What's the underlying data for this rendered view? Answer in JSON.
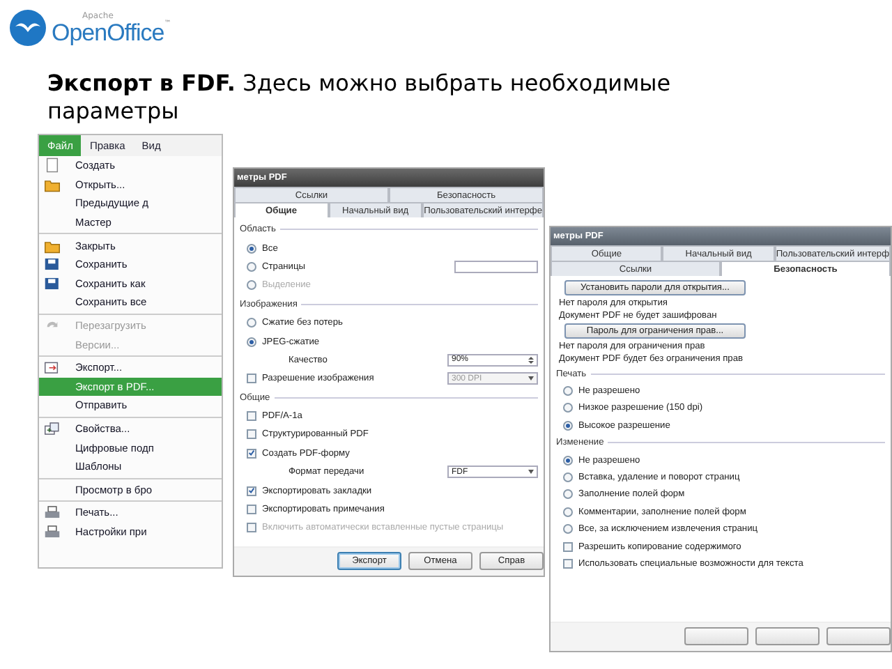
{
  "logo": {
    "vendor": "Apache",
    "name": "OpenOffice",
    "mark": "™"
  },
  "heading": "**Экспорт в FDF.** Здесь можно выбрать необходимые параметры",
  "menu": {
    "menubar": [
      {
        "label": "Файл",
        "selected": true
      },
      {
        "label": "Правка",
        "selected": false
      },
      {
        "label": "Вид",
        "selected": false
      }
    ],
    "items": [
      {
        "kind": "item",
        "label": "Создать",
        "selected": false,
        "disabled": false
      },
      {
        "kind": "item",
        "label": "Открыть...",
        "selected": false,
        "disabled": false
      },
      {
        "kind": "item",
        "label": "Предыдущие д",
        "selected": false,
        "disabled": false
      },
      {
        "kind": "item",
        "label": "Мастер",
        "selected": false,
        "disabled": false
      },
      {
        "kind": "separator"
      },
      {
        "kind": "item",
        "label": "Закрыть",
        "selected": false,
        "disabled": false
      },
      {
        "kind": "item",
        "label": "Сохранить",
        "selected": false,
        "disabled": false
      },
      {
        "kind": "item",
        "label": "Сохранить как",
        "selected": false,
        "disabled": false
      },
      {
        "kind": "item",
        "label": "Сохранить все",
        "selected": false,
        "disabled": false
      },
      {
        "kind": "separator"
      },
      {
        "kind": "item",
        "label": "Перезагрузить",
        "selected": false,
        "disabled": true
      },
      {
        "kind": "item",
        "label": "Версии...",
        "selected": false,
        "disabled": true
      },
      {
        "kind": "separator"
      },
      {
        "kind": "item",
        "label": "Экспорт...",
        "selected": false,
        "disabled": false
      },
      {
        "kind": "item",
        "label": "Экспорт в PDF...",
        "selected": true,
        "disabled": false
      },
      {
        "kind": "item",
        "label": "Отправить",
        "selected": false,
        "disabled": false
      },
      {
        "kind": "separator"
      },
      {
        "kind": "item",
        "label": "Свойства...",
        "selected": false,
        "disabled": false
      },
      {
        "kind": "item",
        "label": "Цифровые подп",
        "selected": false,
        "disabled": false
      },
      {
        "kind": "item",
        "label": "Шаблоны",
        "selected": false,
        "disabled": false
      },
      {
        "kind": "separator"
      },
      {
        "kind": "item",
        "label": "Просмотр в бро",
        "selected": false,
        "disabled": false
      },
      {
        "kind": "separator"
      },
      {
        "kind": "item",
        "label": "Печать...",
        "selected": false,
        "disabled": false
      },
      {
        "kind": "item",
        "label": "Настройки при",
        "selected": false,
        "disabled": false
      }
    ]
  },
  "dialogs": [
    {
      "title": "метры PDF",
      "tabs_back": [
        {
          "label": "Ссылки",
          "selected": false
        },
        {
          "label": "Безопасность",
          "selected": false
        }
      ],
      "tabs_front": [
        {
          "label": "Общие",
          "selected": true
        },
        {
          "label": "Начальный вид",
          "selected": false
        },
        {
          "label": "Пользовательский интерфе",
          "selected": false
        }
      ],
      "rows": [
        {
          "kind": "section",
          "label": "Область"
        },
        {
          "kind": "radio",
          "label": "Все",
          "selected": true,
          "disabled": false
        },
        {
          "kind": "radiofield",
          "label": "Страницы",
          "selected": false,
          "disabled": false
        },
        {
          "kind": "radio",
          "label": "Выделение",
          "selected": false,
          "disabled": true
        },
        {
          "kind": "section",
          "label": "Изображения"
        },
        {
          "kind": "radio",
          "label": "Сжатие без потерь",
          "selected": false,
          "disabled": false
        },
        {
          "kind": "radio",
          "label": "JPEG-сжатие",
          "selected": true,
          "disabled": false
        },
        {
          "kind": "spin",
          "label": "Качество",
          "value": "90%"
        },
        {
          "kind": "checkselect",
          "label": "Разрешение изображения",
          "checked": false,
          "disabled": false,
          "value": "300 DPI"
        },
        {
          "kind": "section",
          "label": "Общие"
        },
        {
          "kind": "checkbox",
          "label": "PDF/A-1a",
          "checked": false,
          "disabled": false
        },
        {
          "kind": "checkbox",
          "label": "Структурированный PDF",
          "checked": false,
          "disabled": false
        },
        {
          "kind": "checkbox",
          "label": "Создать PDF-форму",
          "checked": true,
          "disabled": false
        },
        {
          "kind": "select",
          "label": "Формат передачи",
          "value": "FDF"
        },
        {
          "kind": "checkbox",
          "label": "Экспортировать закладки",
          "checked": true,
          "disabled": false
        },
        {
          "kind": "checkbox",
          "label": "Экспортировать примечания",
          "checked": false,
          "disabled": false
        },
        {
          "kind": "checkbox",
          "label": "Включить автоматически вставленные пустые страницы",
          "checked": false,
          "disabled": true
        }
      ],
      "buttons": [
        {
          "label": "Экспорт",
          "selected": true
        },
        {
          "label": "Отмена",
          "selected": false
        },
        {
          "label": "Справ",
          "selected": false
        }
      ]
    },
    {
      "title": "метры PDF",
      "tabs_back": [
        {
          "label": "Общие",
          "selected": false
        },
        {
          "label": "Начальный вид",
          "selected": false
        },
        {
          "label": "Пользовательский интерф",
          "selected": false
        }
      ],
      "tabs_front": [
        {
          "label": "Ссылки",
          "selected": false
        },
        {
          "label": "Безопасность",
          "selected": true
        }
      ],
      "rows": [
        {
          "kind": "button",
          "label": "Установить пароли для открытия..."
        },
        {
          "kind": "text",
          "label": "Нет пароля для открытия"
        },
        {
          "kind": "text",
          "label": "Документ PDF не будет зашифрован"
        },
        {
          "kind": "button",
          "label": "Пароль для ограничения прав..."
        },
        {
          "kind": "text",
          "label": "Нет пароля для ограничения прав"
        },
        {
          "kind": "text",
          "label": "Документ PDF будет без ограничения прав"
        },
        {
          "kind": "section",
          "label": "Печать"
        },
        {
          "kind": "radio",
          "label": "Не разрешено",
          "selected": false,
          "disabled": false
        },
        {
          "kind": "radio",
          "label": "Низкое разрешение (150 dpi)",
          "selected": false,
          "disabled": false
        },
        {
          "kind": "radio",
          "label": "Высокое разрешение",
          "selected": true,
          "disabled": false
        },
        {
          "kind": "section",
          "label": "Изменение"
        },
        {
          "kind": "radio",
          "label": "Не разрешено",
          "selected": true,
          "disabled": false
        },
        {
          "kind": "radio",
          "label": "Вставка, удаление и поворот страниц",
          "selected": false,
          "disabled": false
        },
        {
          "kind": "radio",
          "label": "Заполнение полей форм",
          "selected": false,
          "disabled": false
        },
        {
          "kind": "radio",
          "label": "Комментарии, заполнение полей форм",
          "selected": false,
          "disabled": false
        },
        {
          "kind": "radio",
          "label": "Все, за исключением извлечения страниц",
          "selected": false,
          "disabled": false
        },
        {
          "kind": "checkbox",
          "label": "Разрешить копирование содержимого",
          "checked": false,
          "disabled": false
        },
        {
          "kind": "checkbox",
          "label": "Использовать специальные возможности для текста",
          "checked": false,
          "disabled": false
        }
      ],
      "buttons": [
        {
          "selected": false
        },
        {
          "selected": false
        },
        {
          "selected": false
        }
      ]
    }
  ]
}
